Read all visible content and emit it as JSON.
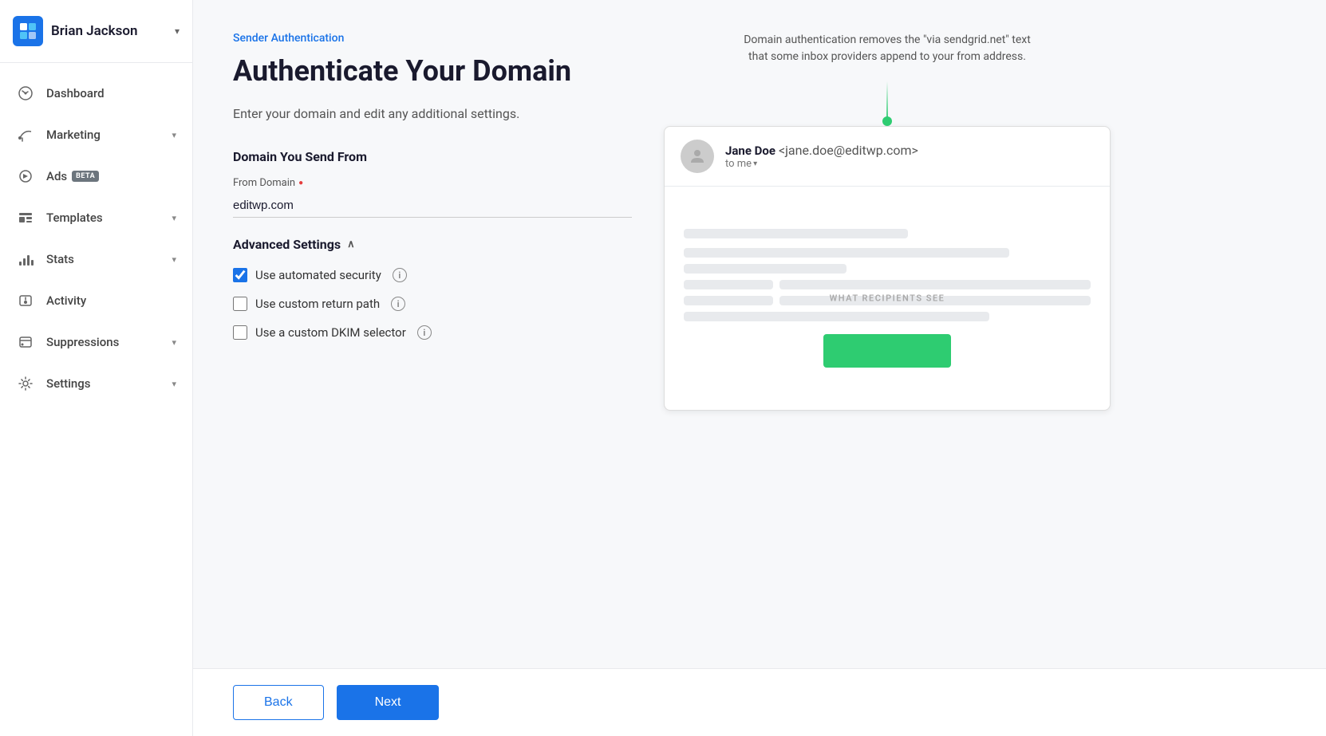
{
  "sidebar": {
    "user": {
      "name": "Brian Jackson",
      "chevron": "▾"
    },
    "nav": [
      {
        "id": "dashboard",
        "label": "Dashboard",
        "icon": "dashboard",
        "chevron": false,
        "beta": false
      },
      {
        "id": "marketing",
        "label": "Marketing",
        "icon": "marketing",
        "chevron": true,
        "beta": false
      },
      {
        "id": "ads",
        "label": "Ads",
        "icon": "ads",
        "chevron": false,
        "beta": true
      },
      {
        "id": "templates",
        "label": "Templates",
        "icon": "templates",
        "chevron": true,
        "beta": false
      },
      {
        "id": "stats",
        "label": "Stats",
        "icon": "stats",
        "chevron": true,
        "beta": false
      },
      {
        "id": "activity",
        "label": "Activity",
        "icon": "activity",
        "chevron": false,
        "beta": false
      },
      {
        "id": "suppressions",
        "label": "Suppressions",
        "icon": "suppressions",
        "chevron": true,
        "beta": false
      },
      {
        "id": "settings",
        "label": "Settings",
        "icon": "settings",
        "chevron": true,
        "beta": false
      }
    ]
  },
  "page": {
    "breadcrumb": "Sender Authentication",
    "title": "Authenticate Your Domain",
    "subtitle": "Enter your domain and edit any additional settings.",
    "domain_section_title": "Domain You Send From",
    "field_label": "From Domain",
    "field_required": true,
    "field_value": "editwp.com",
    "advanced_settings_label": "Advanced Settings",
    "checkboxes": [
      {
        "id": "automated-security",
        "label": "Use automated security",
        "checked": true
      },
      {
        "id": "custom-return-path",
        "label": "Use custom return path",
        "checked": false
      },
      {
        "id": "custom-dkim",
        "label": "Use a custom DKIM selector",
        "checked": false
      }
    ]
  },
  "preview": {
    "description": "Domain authentication removes the \"via sendgrid.net\" text that some inbox providers append to your from address.",
    "email": {
      "sender_name": "Jane Doe",
      "sender_email": "<jane.doe@editwp.com>",
      "to_label": "to me",
      "body_label": "WHAT RECIPIENTS SEE"
    }
  },
  "footer": {
    "back_label": "Back",
    "next_label": "Next"
  }
}
